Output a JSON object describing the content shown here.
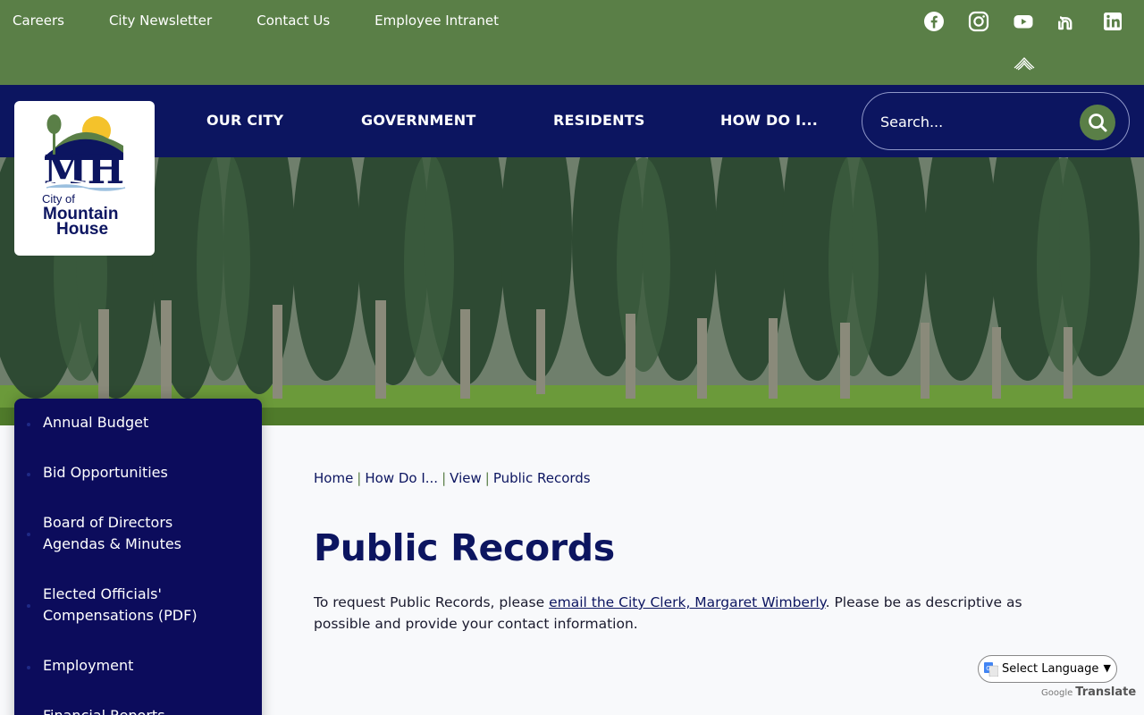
{
  "topbar": {
    "links": [
      "Careers",
      "City Newsletter",
      "Contact Us",
      "Employee Intranet"
    ],
    "social_icons": [
      "facebook-icon",
      "instagram-icon",
      "youtube-icon",
      "nextdoor-icon",
      "linkedin-icon"
    ],
    "extra_icon": "wing-logo-icon"
  },
  "nav": {
    "items": [
      "OUR CITY",
      "GOVERNMENT",
      "RESIDENTS",
      "HOW DO I..."
    ],
    "search_placeholder": "Search..."
  },
  "logo": {
    "monogram": "MH",
    "line1": "City of",
    "line2": "Mountain",
    "line3": "House"
  },
  "sidebar": {
    "items": [
      "Annual Budget",
      "Bid Opportunities",
      "Board of Directors Agendas & Minutes",
      "Elected Officials' Compensations (PDF)",
      "Employment",
      "Financial Reports"
    ]
  },
  "breadcrumb": [
    "Home",
    "How Do I...",
    "View",
    "Public Records"
  ],
  "page": {
    "title": "Public Records",
    "text_before": "To request Public Records, please ",
    "link_text": "email the City Clerk, Margaret Wimberly",
    "text_after": ". Please be as descriptive as possible and provide your contact information."
  },
  "translate": {
    "select_label": "Select Language",
    "powered_by": "Google",
    "powered_label": "Translate"
  },
  "colors": {
    "green": "#5a7f47",
    "navy": "#0c1560",
    "sidebar": "#0c0c5c"
  }
}
